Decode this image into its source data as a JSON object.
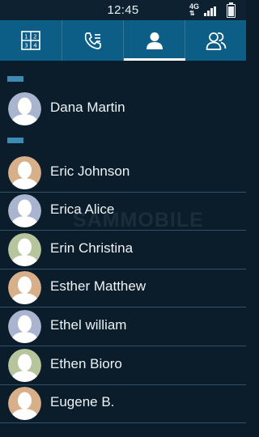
{
  "status": {
    "time": "12:45",
    "network": "4G"
  },
  "tabs": [
    {
      "name": "keypad-icon",
      "active": false
    },
    {
      "name": "call-log-icon",
      "active": false
    },
    {
      "name": "contacts-icon",
      "active": true
    },
    {
      "name": "groups-icon",
      "active": false
    }
  ],
  "contacts": [
    {
      "label": "Dana Martin",
      "color": "#a9b4cf"
    },
    {
      "label": "Eric Johnson",
      "color": "#d7b08a"
    },
    {
      "label": "Erica Alice",
      "color": "#a9b4cf"
    },
    {
      "label": "Erin Christina",
      "color": "#b7c59d"
    },
    {
      "label": "Esther Matthew",
      "color": "#d7b08a"
    },
    {
      "label": "Ethel william",
      "color": "#a9b4cf"
    },
    {
      "label": "Ethen Bioro",
      "color": "#b7c59d"
    },
    {
      "label": "Eugene B.",
      "color": "#d7b08a"
    }
  ],
  "watermark": "SAMMOBILE"
}
